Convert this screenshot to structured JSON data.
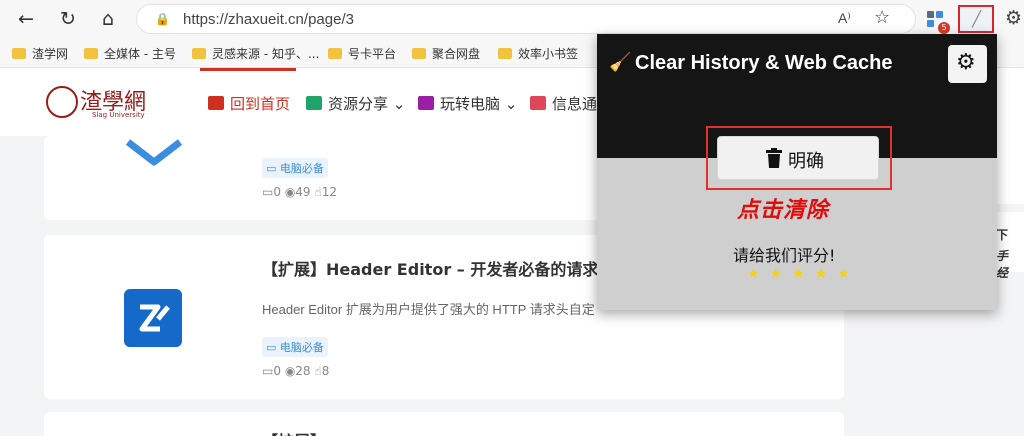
{
  "browser": {
    "url": "https://zhaxueit.cn/page/3",
    "reader_label": "A⁾",
    "extension_badge": "5"
  },
  "bookmarks": [
    "渣学网",
    "全媒体 - 主号",
    "灵感来源 - 知乎、...",
    "号卡平台",
    "聚合网盘",
    "效率小书签"
  ],
  "site": {
    "logo_text": "渣學網",
    "logo_sub": "Slag University",
    "nav": [
      {
        "label": "回到首页",
        "color": "#d0301f"
      },
      {
        "label": "资源分享",
        "color": "#1fa36b"
      },
      {
        "label": "玩转电脑",
        "color": "#9b1fa3"
      },
      {
        "label": "信息通",
        "color": "#e0465a"
      }
    ]
  },
  "cards": [
    {
      "tag": "电脑必备",
      "comments": "0",
      "views": "49",
      "likes": "12"
    },
    {
      "title": "【扩展】Header Editor – 开发者必备的请求",
      "desc": "Header Editor 扩展为用户提供了强大的 HTTP 请求头自定",
      "tag": "电脑必备",
      "comments": "0",
      "views": "28",
      "likes": "8"
    },
    {
      "title": "【扩展】"
    }
  ],
  "sidebar": {
    "text1": "下",
    "text2": "手 经"
  },
  "popup": {
    "title": "Clear History & Web Cache",
    "clear_label": "明确",
    "caption": "点击清除",
    "rate_text": "请给我们评分!",
    "stars": "★★★★★",
    "star_rating": 5
  }
}
